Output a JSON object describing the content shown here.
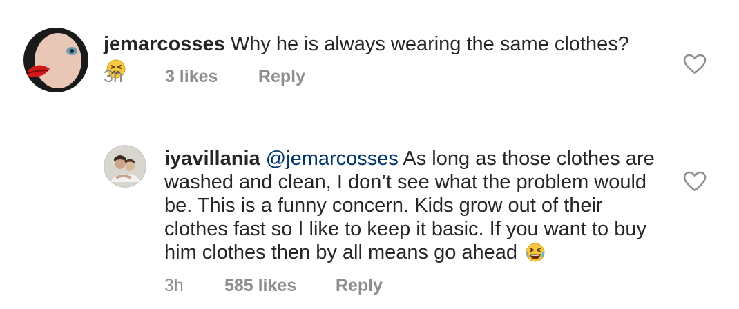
{
  "comments": [
    {
      "username": "jemarcosses",
      "text": "Why he is always wearing the same clothes?",
      "emoji": "persevering-face",
      "time": "3h",
      "likes": "3 likes",
      "reply_label": "Reply"
    },
    {
      "username": "iyavillania",
      "mention": "@jemarcosses",
      "text": "As long as those clothes are washed and clean, I don’t see what the problem would be. This is a funny concern. Kids grow out of their clothes fast so I like to keep it basic. If you want to buy him clothes then by all means  go ahead",
      "emoji": "grinning-squinting-face",
      "time": "3h",
      "likes": "585 likes",
      "reply_label": "Reply"
    }
  ],
  "colors": {
    "text": "#262626",
    "meta": "#8e8e8e",
    "mention": "#003569",
    "heart_outline": "#8e8e8e"
  }
}
